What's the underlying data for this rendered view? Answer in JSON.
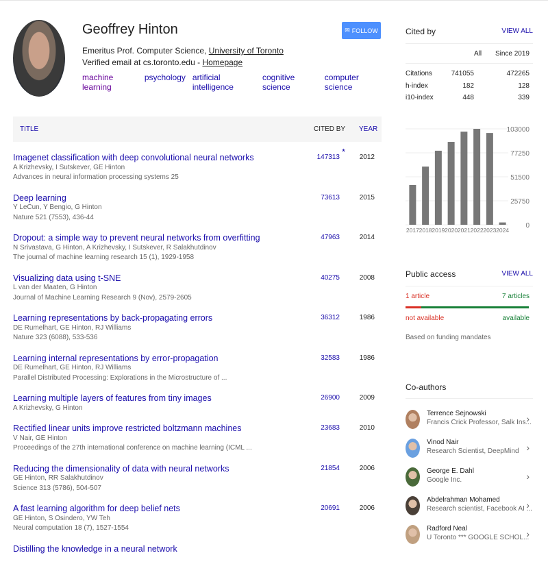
{
  "profile": {
    "name": "Geoffrey Hinton",
    "follow_label": "FOLLOW",
    "affiliation_prefix": "Emeritus Prof. Computer Science, ",
    "affiliation_link": "University of Toronto",
    "email_prefix": "Verified email at cs.toronto.edu - ",
    "homepage": "Homepage",
    "interests": [
      "machine learning",
      "psychology",
      "artificial intelligence",
      "cognitive science",
      "computer science"
    ]
  },
  "table": {
    "headers": {
      "title": "TITLE",
      "cited_by": "CITED BY",
      "year": "YEAR"
    },
    "rows": [
      {
        "title": "Imagenet classification with deep convolutional neural networks",
        "authors": "A Krizhevsky, I Sutskever, GE Hinton",
        "venue": "Advances in neural information processing systems 25",
        "cited": "147313",
        "star": "*",
        "year": "2012"
      },
      {
        "title": "Deep learning",
        "authors": "Y LeCun, Y Bengio, G Hinton",
        "venue": "Nature 521 (7553), 436-44",
        "cited": "73613",
        "year": "2015"
      },
      {
        "title": "Dropout: a simple way to prevent neural networks from overfitting",
        "authors": "N Srivastava, G Hinton, A Krizhevsky, I Sutskever, R Salakhutdinov",
        "venue": "The journal of machine learning research 15 (1), 1929-1958",
        "cited": "47963",
        "year": "2014"
      },
      {
        "title": "Visualizing data using t-SNE",
        "authors": "L van der Maaten, G Hinton",
        "venue": "Journal of Machine Learning Research 9 (Nov), 2579-2605",
        "cited": "40275",
        "year": "2008"
      },
      {
        "title": "Learning representations by back-propagating errors",
        "authors": "DE Rumelhart, GE Hinton, RJ Williams",
        "venue": "Nature 323 (6088), 533-536",
        "cited": "36312",
        "year": "1986"
      },
      {
        "title": "Learning internal representations by error-propagation",
        "authors": "DE Rumelhart, GE Hinton, RJ Williams",
        "venue": "Parallel Distributed Processing: Explorations in the Microstructure of ...",
        "cited": "32583",
        "year": "1986"
      },
      {
        "title": "Learning multiple layers of features from tiny images",
        "authors": "A Krizhevsky, G Hinton",
        "cited": "26900",
        "year": "2009"
      },
      {
        "title": "Rectified linear units improve restricted boltzmann machines",
        "authors": "V Nair, GE Hinton",
        "venue": "Proceedings of the 27th international conference on machine learning (ICML ...",
        "cited": "23683",
        "year": "2010"
      },
      {
        "title": "Reducing the dimensionality of data with neural networks",
        "authors": "GE Hinton, RR Salakhutdinov",
        "venue": "Science 313 (5786), 504-507",
        "cited": "21854",
        "year": "2006"
      },
      {
        "title": "A fast learning algorithm for deep belief nets",
        "authors": "GE Hinton, S Osindero, YW Teh",
        "venue": "Neural computation 18 (7), 1527-1554",
        "cited": "20691",
        "year": "2006"
      },
      {
        "title": "Distilling the knowledge in a neural network",
        "authors": "",
        "venue": "",
        "cited": "",
        "year": ""
      }
    ]
  },
  "cited_by": {
    "heading": "Cited by",
    "view_all": "VIEW ALL",
    "col_all": "All",
    "col_since": "Since 2019",
    "stats": [
      {
        "label": "Citations",
        "all": "741055",
        "since": "472265"
      },
      {
        "label": "h-index",
        "all": "182",
        "since": "128"
      },
      {
        "label": "i10-index",
        "all": "448",
        "since": "339"
      }
    ]
  },
  "chart_data": {
    "type": "bar",
    "categories": [
      "2017",
      "2018",
      "2019",
      "2020",
      "2021",
      "2022",
      "2023",
      "2024"
    ],
    "values": [
      42700,
      62500,
      79500,
      89000,
      100000,
      103000,
      98500,
      2500
    ],
    "yticks": [
      "103000",
      "77250",
      "51500",
      "25750",
      "0"
    ],
    "ylim": [
      0,
      103000
    ],
    "grid": true,
    "bar_color": "#777777"
  },
  "public_access": {
    "heading": "Public access",
    "view_all": "VIEW ALL",
    "not_available_count": "1 article",
    "available_count": "7 articles",
    "not_available_label": "not available",
    "available_label": "available",
    "not_available_fraction": 0.125,
    "note": "Based on funding mandates",
    "colors": {
      "not_available": "#d93025",
      "available": "#188038"
    }
  },
  "coauthors": {
    "heading": "Co-authors",
    "items": [
      {
        "name": "Terrence Sejnowski",
        "affiliation": "Francis Crick Professor, Salk Ins..."
      },
      {
        "name": "Vinod Nair",
        "affiliation": "Research Scientist, DeepMind"
      },
      {
        "name": "George E. Dahl",
        "affiliation": "Google Inc."
      },
      {
        "name": "Abdelrahman Mohamed",
        "affiliation": "Research scientist, Facebook AI ..."
      },
      {
        "name": "Radford Neal",
        "affiliation": "U Toronto *** GOOGLE SCHOL..."
      }
    ]
  }
}
